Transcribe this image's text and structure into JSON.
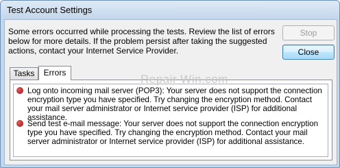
{
  "window": {
    "title": "Test Account Settings"
  },
  "message": "Some errors occurred while processing the tests. Review the list of errors below for more details. If the problem persist after taking the suggested actions, contact your Internet Service Provider.",
  "buttons": {
    "stop": "Stop",
    "close": "Close"
  },
  "tabs": [
    {
      "label": "Tasks"
    },
    {
      "label": "Errors"
    }
  ],
  "errors": [
    {
      "icon": "error-icon",
      "text": "Log onto incoming mail server (POP3): Your server does not support the connection encryption type you have specified. Try changing the encryption method. Contact your mail server administrator or Internet service provider (ISP) for additional assistance."
    },
    {
      "icon": "error-icon",
      "text": "Send test e-mail message: Your server does not support the connection encryption type you have specified. Try changing the encryption method. Contact your mail server administrator or Internet service provider (ISP) for additional assistance."
    }
  ],
  "watermark": "Repair Win.com"
}
